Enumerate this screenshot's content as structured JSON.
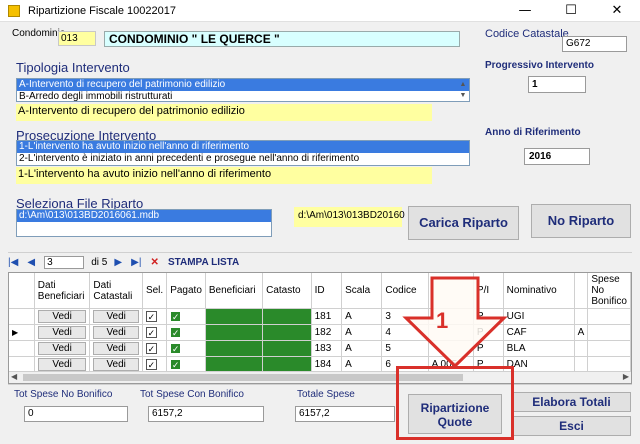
{
  "window": {
    "title": "Ripartizione Fiscale  10022017",
    "minimize": "—",
    "maximize": "☐",
    "close": "✕"
  },
  "condominio": {
    "label": "Condominio",
    "code": "013",
    "name": "CONDOMINIO \" LE QUERCE \""
  },
  "codice_catastale": {
    "label": "Codice Catastale",
    "value": "G672"
  },
  "progressivo": {
    "label": "Progressivo Intervento",
    "value": "1"
  },
  "anno": {
    "label": "Anno di Riferimento",
    "value": "2016"
  },
  "tipologia": {
    "label": "Tipologia Intervento",
    "items": [
      "A-Intervento di recupero del patrimonio edilizio",
      "B-Arredo degli immobili ristrutturati"
    ],
    "selected_text": "A-Intervento di recupero del patrimonio edilizio"
  },
  "prosecuzione": {
    "label": "Prosecuzione Intervento",
    "items": [
      "1-L'intervento ha avuto inizio nell'anno di riferimento",
      "2-L'intervento è iniziato in anni precedenti e prosegue nell'anno di riferimento"
    ],
    "selected_text": "1-L'intervento ha avuto inizio nell'anno di riferimento"
  },
  "file_riparto": {
    "label": "Seleziona File Riparto",
    "item": "d:\\Am\\013\\013BD2016061.mdb",
    "path_display": "d:\\Am\\013\\013BD20160"
  },
  "buttons": {
    "carica_riparto": "Carica Riparto",
    "no_riparto": "No Riparto",
    "ripartizione_quote": "Ripartizione Quote",
    "elabora_totali": "Elabora Totali",
    "esci": "Esci"
  },
  "navigator": {
    "current": "3",
    "of_text": "di 5",
    "stampa_lista": "STAMPA LISTA"
  },
  "grid": {
    "columns": [
      "",
      "Dati Beneficiari",
      "Dati Catastali",
      "Sel.",
      "Pagato",
      "Beneficiari",
      "Catasto",
      "ID",
      "Scala",
      "Codice",
      "",
      "P/I",
      "Nominativo",
      "",
      "Spese No Bonifico"
    ],
    "rows": [
      {
        "btn1": "Vedi",
        "btn2": "Vedi",
        "sel": "✓",
        "pagato": "✓",
        "id": "181",
        "scala": "A",
        "codice": "3",
        "extra": "",
        "pi": "P",
        "nominativo": "UGI",
        "extra2": ""
      },
      {
        "btn1": "Vedi",
        "btn2": "Vedi",
        "sel": "✓",
        "pagato": "✓",
        "id": "182",
        "scala": "A",
        "codice": "4",
        "extra": "",
        "pi": "P",
        "nominativo": "CAF",
        "extra2": "A"
      },
      {
        "btn1": "Vedi",
        "btn2": "Vedi",
        "sel": "✓",
        "pagato": "✓",
        "id": "183",
        "scala": "A",
        "codice": "5",
        "extra": "",
        "pi": "P",
        "nominativo": "BLA",
        "extra2": ""
      },
      {
        "btn1": "Vedi",
        "btn2": "Vedi",
        "sel": "✓",
        "pagato": "✓",
        "id": "184",
        "scala": "A",
        "codice": "6",
        "extra": "A 005",
        "pi": "P",
        "nominativo": "DAN",
        "extra2": ""
      }
    ]
  },
  "totals": {
    "no_bonifico_label": "Tot Spese No Bonifico",
    "no_bonifico_value": "0",
    "con_bonifico_label": "Tot Spese Con Bonifico",
    "con_bonifico_value": "6157,2",
    "totale_label": "Totale Spese",
    "totale_value": "6157,2"
  },
  "annotation": {
    "number": "1",
    "color": "#d9302a"
  }
}
